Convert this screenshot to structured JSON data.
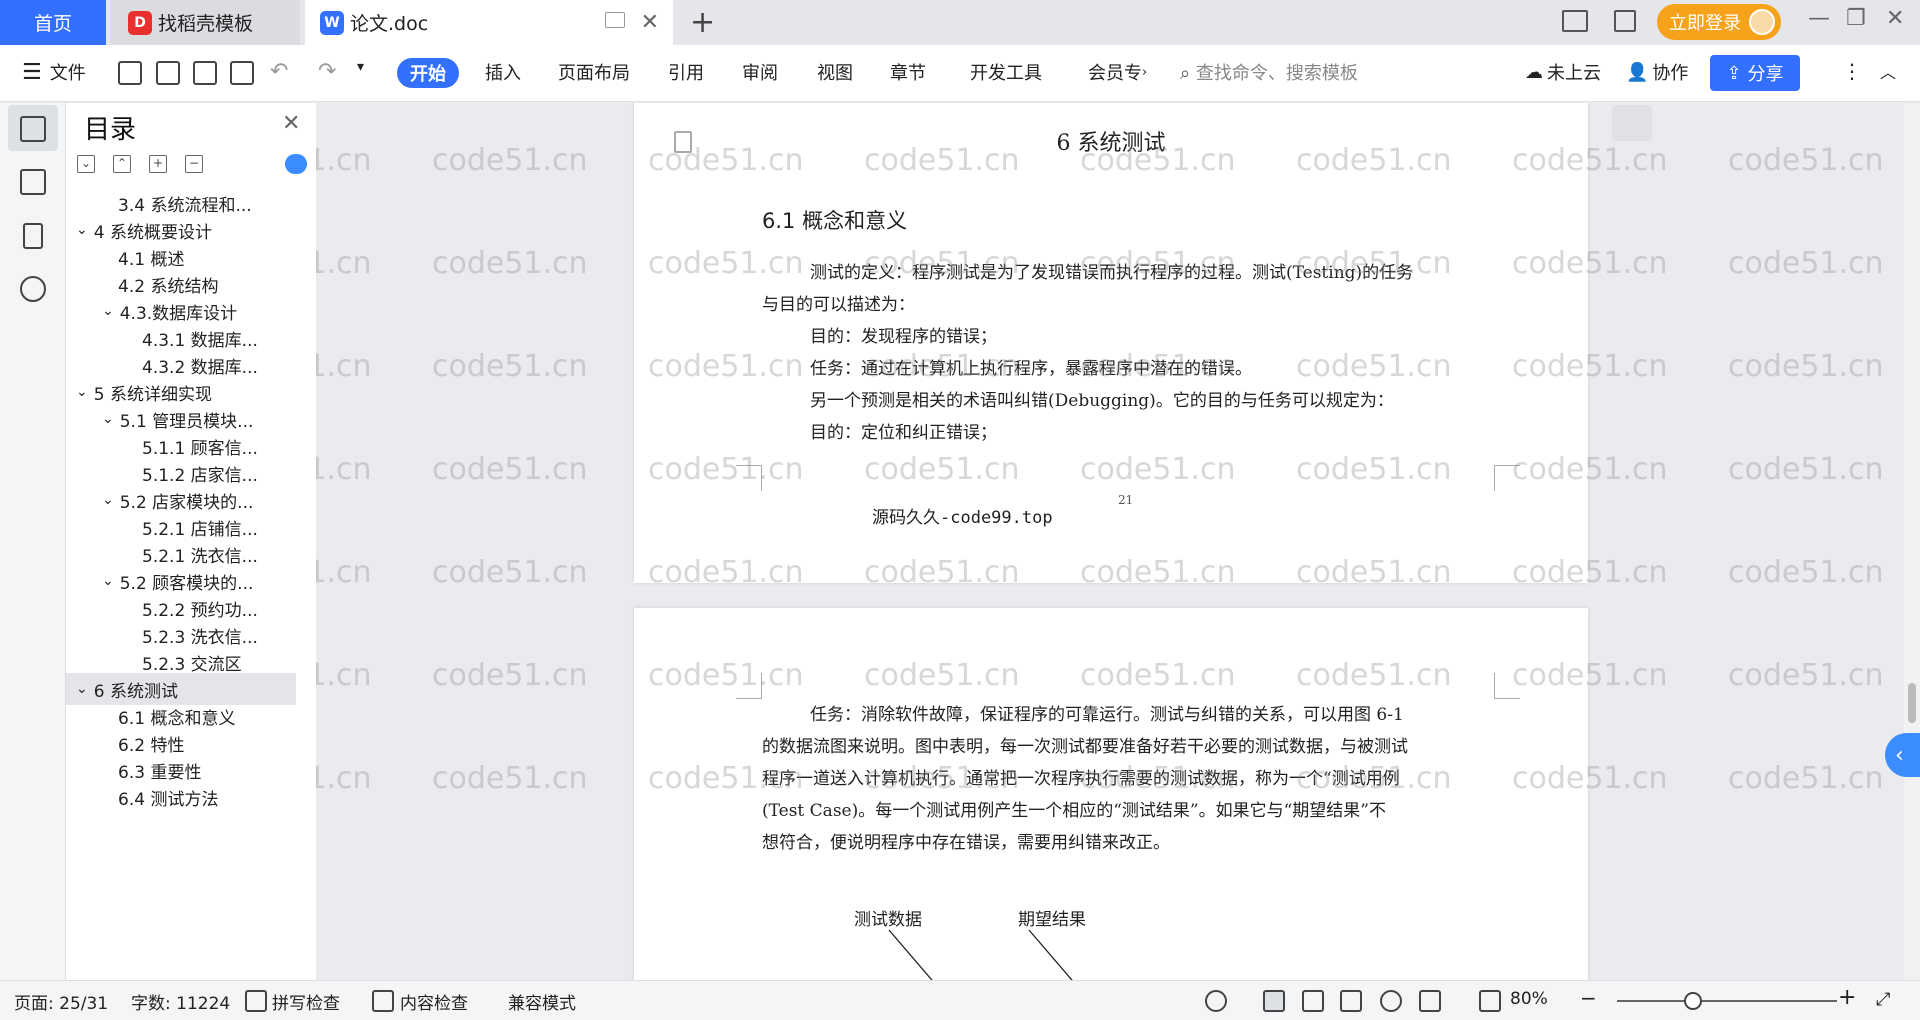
{
  "tabs": {
    "home": "首页",
    "template": "找稻壳模板",
    "document": "论文.doc",
    "template_icon": "daoke-logo-icon",
    "doc_icon": "wps-writer-icon"
  },
  "account": {
    "login_label": "立即登录"
  },
  "ribbon": {
    "file": "文件",
    "start": "开始",
    "insert": "插入",
    "layout": "页面布局",
    "reference": "引用",
    "review": "审阅",
    "view": "视图",
    "chapter": "章节",
    "devtools": "开发工具",
    "member": "会员专",
    "search_placeholder": "查找命令、搜索模板",
    "cloud": "未上云",
    "collab": "协作",
    "share": "分享"
  },
  "toc": {
    "title": "目录",
    "items": [
      {
        "label": "3.4 系统流程和..."
      },
      {
        "label": "4 系统概要设计"
      },
      {
        "label": "4.1 概述"
      },
      {
        "label": "4.2 系统结构"
      },
      {
        "label": "4.3.数据库设计"
      },
      {
        "label": "4.3.1 数据库..."
      },
      {
        "label": "4.3.2 数据库..."
      },
      {
        "label": "5 系统详细实现"
      },
      {
        "label": "5.1 管理员模块..."
      },
      {
        "label": "5.1.1 顾客信..."
      },
      {
        "label": "5.1.2 店家信..."
      },
      {
        "label": "5.2 店家模块的..."
      },
      {
        "label": "5.2.1 店铺信..."
      },
      {
        "label": "5.2.1 洗衣信..."
      },
      {
        "label": "5.2 顾客模块的..."
      },
      {
        "label": "5.2.2 预约功..."
      },
      {
        "label": "5.2.3 洗衣信..."
      },
      {
        "label": "5.2.3 交流区"
      },
      {
        "label": "6 系统测试"
      },
      {
        "label": "6.1 概念和意义"
      },
      {
        "label": "6.2 特性"
      },
      {
        "label": "6.3 重要性"
      },
      {
        "label": "6.4 测试方法"
      }
    ]
  },
  "document": {
    "chapter_title": "6 系统测试",
    "section_title": "6.1 概念和意义",
    "page1_lines": [
      "测试的定义：程序测试是为了发现错误而执行程序的过程。测试(Testing)的任务",
      "与目的可以描述为：",
      "目的：发现程序的错误；",
      "任务：通过在计算机上执行程序，暴露程序中潜在的错误。",
      "另一个预测是相关的术语叫纠错(Debugging)。它的目的与任务可以规定为：",
      "目的：定位和纠正错误；"
    ],
    "page_number": "21",
    "footer_text": "源码久久-code99.top",
    "page2_lines": [
      "任务：消除软件故障，保证程序的可靠运行。测试与纠错的关系，可以用图 6-1",
      "的数据流图来说明。图中表明，每一次测试都要准备好若干必要的测试数据，与被测试",
      "程序一道送入计算机执行。通常把一次程序执行需要的测试数据，称为一个“测试用例",
      "(Test Case)。每一个测试用例产生一个相应的“测试结果”。如果它与“期望结果”不",
      "想符合，便说明程序中存在错误，需要用纠错来改正。"
    ],
    "diagram_labels": [
      "测试数据",
      "期望结果"
    ]
  },
  "watermark": "code51.cn",
  "status": {
    "page": "页面: 25/31",
    "words": "字数: 11224",
    "spell": "拼写检查",
    "content_check": "内容检查",
    "compat": "兼容模式",
    "zoom": "80%"
  },
  "colors": {
    "accent": "#3370ff",
    "login": "#f6a31b"
  }
}
